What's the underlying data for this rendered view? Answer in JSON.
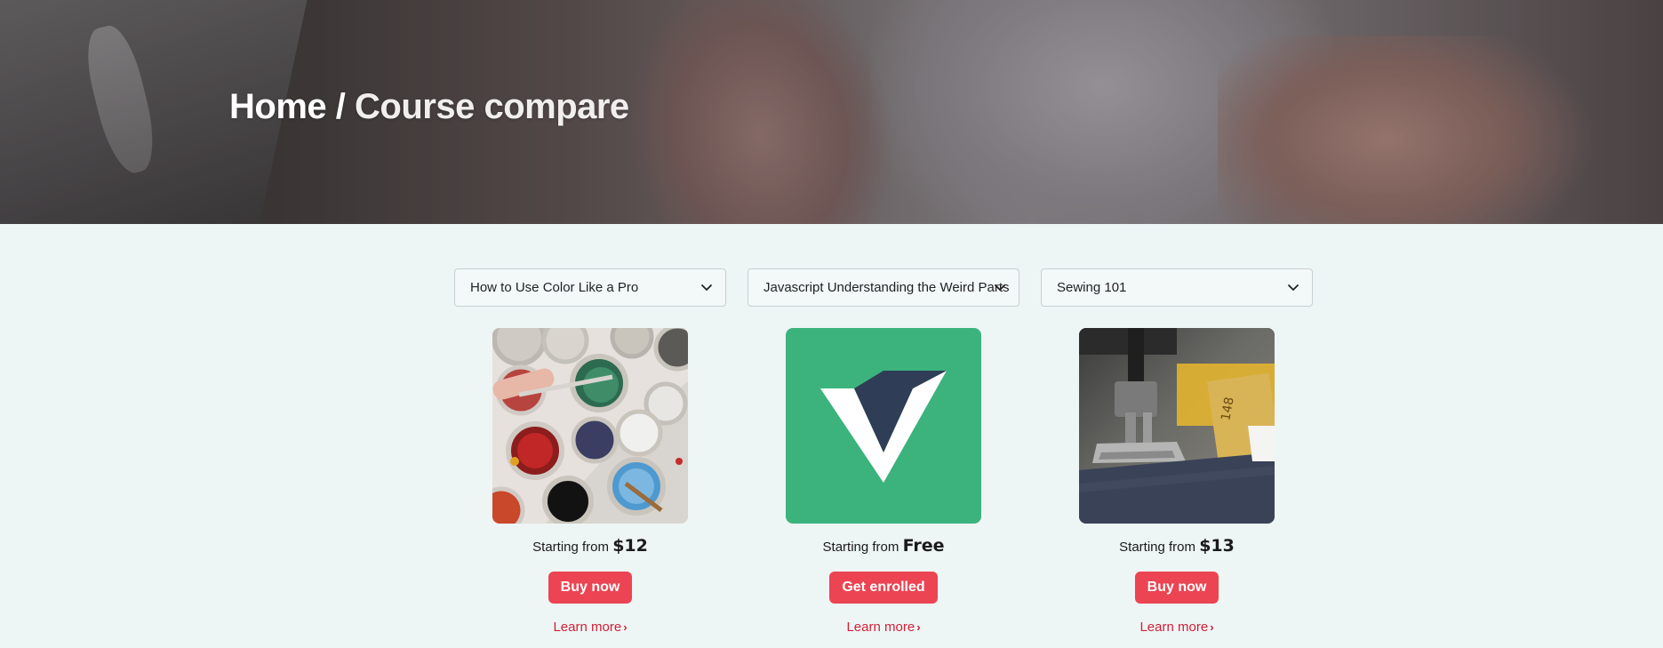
{
  "hero": {
    "home_label": "Home",
    "separator": "/",
    "current_label": "Course compare"
  },
  "courses": [
    {
      "select_value": "How to Use Color Like a Pro",
      "price_prefix": "Starting from",
      "price": "$12",
      "button_label": "Buy now",
      "learn_more": "Learn more",
      "image_icon": "paint-cans-image"
    },
    {
      "select_value": "Javascript Understanding the Weird Parts",
      "price_prefix": "Starting from",
      "price": "Free",
      "button_label": "Get enrolled",
      "learn_more": "Learn more",
      "image_icon": "vue-logo-image"
    },
    {
      "select_value": "Sewing 101",
      "price_prefix": "Starting from",
      "price": "$13",
      "button_label": "Buy now",
      "learn_more": "Learn more",
      "image_icon": "sewing-machine-image"
    }
  ],
  "colors": {
    "accent": "#ec4452",
    "link": "#d21f36",
    "page_bg": "#eef5f5",
    "vue_green": "#3cb37d",
    "vue_navy": "#34495e"
  }
}
